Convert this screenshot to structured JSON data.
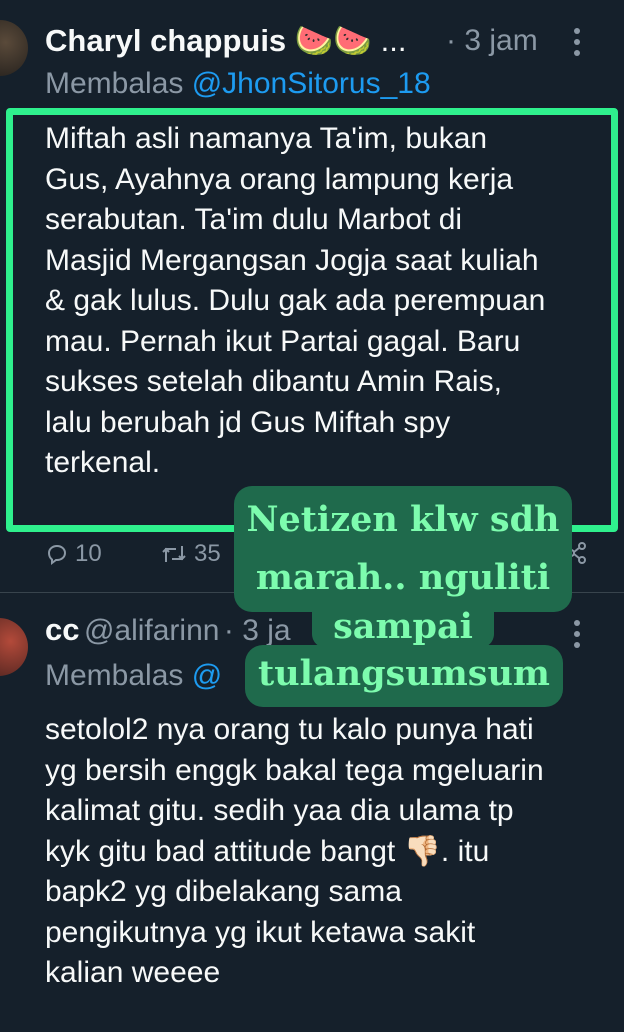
{
  "tweet1": {
    "author": "Charyl chappuis",
    "emoji": "🍉🍉",
    "ellipsis": "...",
    "time": "· 3 jam",
    "more_glyph": "⋮",
    "reply_prefix": "Membalas ",
    "reply_to": "@JhonSitorus_18",
    "text_lines": [
      "Miftah asli namanya Ta'im, bukan",
      "Gus, Ayahnya orang lampung kerja",
      "serabutan. Ta'im dulu Marbot di",
      "Masjid Mergangsan Jogja saat kuliah",
      "& gak lulus. Dulu gak ada perempuan",
      "mau. Pernah ikut Partai gagal. Baru",
      "sukses setelah dibantu Amin Rais,",
      "lalu berubah jd Gus Miftah spy",
      "terkenal."
    ],
    "replies": "10",
    "retweets": "35",
    "highlight_color": "#2ff08d"
  },
  "tweet2": {
    "author": "cc",
    "handle": "@alifarinn",
    "time": "· 3 ja",
    "more_glyph": "⋮",
    "reply_prefix": "Membalas ",
    "reply_to": "@",
    "text_lines": [
      "setolol2 nya orang tu kalo punya hati",
      "yg bersih enggk bakal tega mgeluarin",
      "kalimat gitu. sedih yaa dia ulama tp",
      "kyk gitu bad attitude bangt 👎🏻. itu",
      "bapk2 yg dibelakang sama",
      "pengikutnya yg ikut ketawa sakit",
      "kalian weeee"
    ]
  },
  "overlay": {
    "lines_block1": [
      "Netizen klw sdh",
      "marah.. nguliti"
    ],
    "line_sampai": "sampai",
    "line_tulang": "tulangsumsum",
    "bg_color": "#1f6a4c",
    "text_color": "#7dfcae"
  }
}
